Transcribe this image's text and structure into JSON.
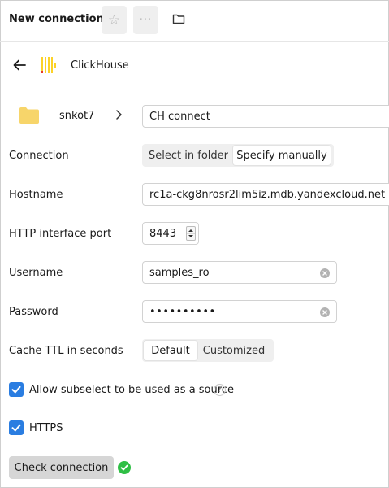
{
  "header": {
    "title": "New connection"
  },
  "connection_type": {
    "name": "ClickHouse"
  },
  "path": {
    "folder": "snkot7",
    "name_value": "CH connect"
  },
  "form": {
    "connection": {
      "label": "Connection",
      "options": [
        "Select in folder",
        "Specify manually"
      ],
      "selected": "Specify manually"
    },
    "hostname": {
      "label": "Hostname",
      "value": "rc1a-ckg8nrosr2lim5iz.mdb.yandexcloud.net"
    },
    "port": {
      "label": "HTTP interface port",
      "value": "8443"
    },
    "username": {
      "label": "Username",
      "value": "samples_ro"
    },
    "password": {
      "label": "Password",
      "value": "••••••••••"
    },
    "cache_ttl": {
      "label": "Cache TTL in seconds",
      "options": [
        "Default",
        "Customized"
      ],
      "selected": "Default"
    },
    "allow_subselect": {
      "label": "Allow subselect to be used as a source",
      "checked": true,
      "help": "?"
    },
    "https": {
      "label": "HTTPS",
      "checked": true
    }
  },
  "actions": {
    "check_connection": "Check connection",
    "check_status": "success"
  },
  "colors": {
    "accent": "#2a7de1",
    "success": "#2fbf45",
    "logo_yellow": "#fcd228",
    "logo_red": "#e8382f",
    "folder": "#f7d56a"
  }
}
